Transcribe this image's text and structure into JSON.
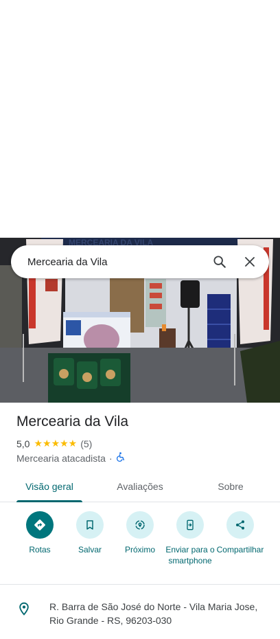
{
  "search": {
    "query": "Mercearia da Vila"
  },
  "photo": {
    "storefront_sign": "MERCEARIA DA VILA"
  },
  "place": {
    "name": "Mercearia da Vila",
    "rating": "5,0",
    "stars": "★★★★★",
    "review_count": "(5)",
    "category": "Mercearia atacadista",
    "separator": "·"
  },
  "tabs": [
    {
      "label": "Visão geral",
      "active": true
    },
    {
      "label": "Avaliações",
      "active": false
    },
    {
      "label": "Sobre",
      "active": false
    }
  ],
  "actions": [
    {
      "label": "Rotas",
      "icon": "directions-icon"
    },
    {
      "label": "Salvar",
      "icon": "bookmark-icon"
    },
    {
      "label": "Próximo",
      "icon": "nearby-icon"
    },
    {
      "label": "Enviar para o smartphone",
      "icon": "send-to-phone-icon"
    },
    {
      "label": "Compartilhar",
      "icon": "share-icon"
    }
  ],
  "address": {
    "text": "R. Barra de São José do Norte - Vila Maria Jose, Rio Grande - RS, 96203-030"
  },
  "colors": {
    "accent": "#00676f",
    "accent_fill": "#00767d",
    "action_bg": "#d6f1f4",
    "star": "#fbbc04"
  }
}
